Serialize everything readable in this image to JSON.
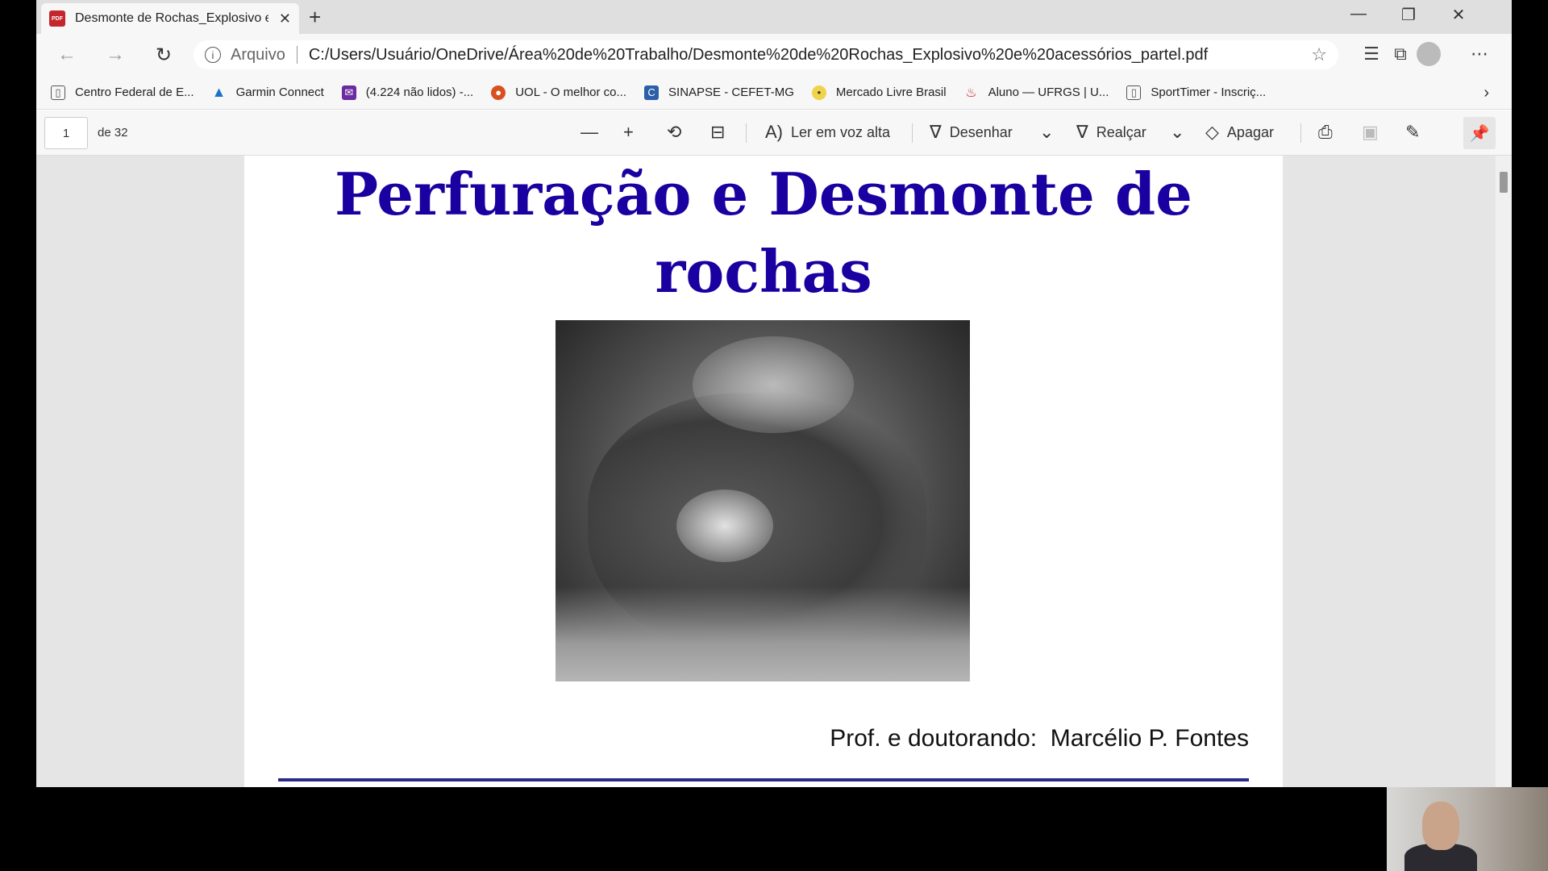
{
  "browser": {
    "tab_title": "Desmonte de Rochas_Explosivo e",
    "tab_icon_text": "PDF",
    "new_tab": "+",
    "window_controls": {
      "minimize": "—",
      "restore": "❐",
      "close": "✕"
    }
  },
  "address": {
    "scheme_label": "Arquivo",
    "url": "C:/Users/Usuário/OneDrive/Área%20de%20Trabalho/Desmonte%20de%20Rochas_Explosivo%20e%20acessórios_partel.pdf"
  },
  "bookmarks": [
    {
      "label": "Centro Federal de E...",
      "icon": "page-icon",
      "color": "#ffffff"
    },
    {
      "label": "Garmin Connect",
      "icon": "garmin-icon",
      "color": "#1a73c8"
    },
    {
      "label": "(4.224 não lidos) -...",
      "icon": "mail-icon",
      "color": "#6a2ca0"
    },
    {
      "label": "UOL - O melhor co...",
      "icon": "uol-icon",
      "color": "#d94f1e"
    },
    {
      "label": "SINAPSE - CEFET-MG",
      "icon": "sinapse-icon",
      "color": "#2c5fa8"
    },
    {
      "label": "Mercado Livre Brasil",
      "icon": "mercadolivre-icon",
      "color": "#f0d34a"
    },
    {
      "label": "Aluno — UFRGS | U...",
      "icon": "ufrgs-icon",
      "color": "#c4262e"
    },
    {
      "label": "SportTimer - Inscriç...",
      "icon": "page-icon",
      "color": "#ffffff"
    }
  ],
  "pdf_toolbar": {
    "page_current": "1",
    "page_total": "de 32",
    "read_aloud": "Ler em voz alta",
    "draw": "Desenhar",
    "highlight": "Realçar",
    "erase": "Apagar"
  },
  "document": {
    "title": "Perfuração e Desmonte de rochas",
    "author": "Prof. e doutorando:  Marcélio P. Fontes"
  },
  "colors": {
    "title": "#1a00a0",
    "rule": "#2a2a8a",
    "pdf_icon": "#c4262e"
  }
}
